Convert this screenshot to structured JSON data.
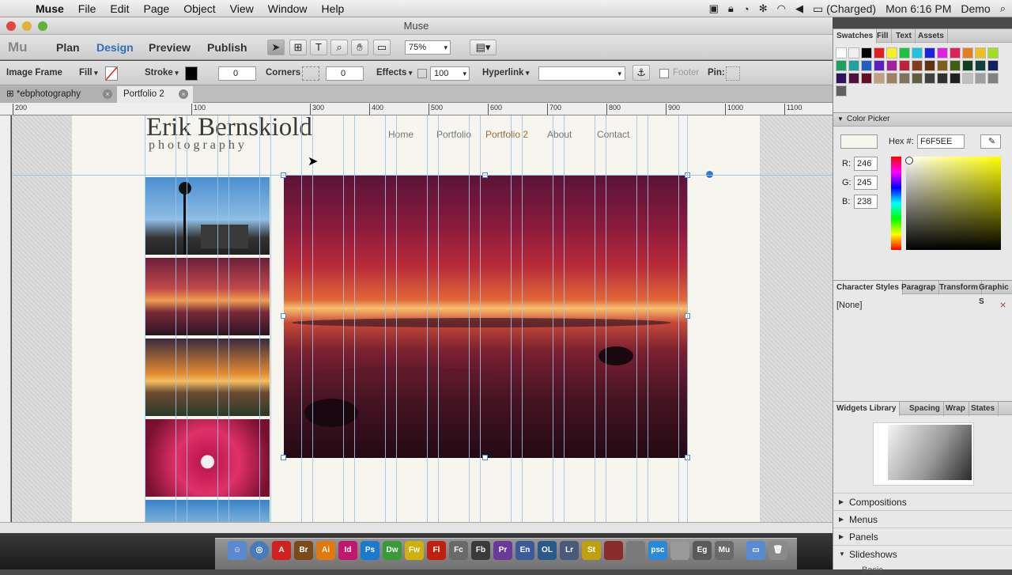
{
  "menubar": {
    "app": "Muse",
    "items": [
      "File",
      "Edit",
      "Page",
      "Object",
      "View",
      "Window",
      "Help"
    ],
    "battery": "(Charged)",
    "clock": "Mon 6:16 PM",
    "user": "Demo"
  },
  "window": {
    "title": "Muse"
  },
  "toolbar": {
    "logo": "Mu",
    "modes": [
      "Plan",
      "Design",
      "Preview",
      "Publish"
    ],
    "active_mode": "Design",
    "zoom": "75%"
  },
  "control_bar": {
    "object_type": "Image Frame",
    "fill_label": "Fill",
    "stroke_label": "Stroke",
    "stroke_width": "0",
    "corners_label": "Corners",
    "corners_value": "0",
    "effects_label": "Effects",
    "opacity": "100",
    "hyperlink_label": "Hyperlink",
    "hyperlink_value": "",
    "footer_label": "Footer",
    "pin_label": "Pin:"
  },
  "tabs": [
    "*ebphotography",
    "Portfolio 2"
  ],
  "active_tab": "Portfolio 2",
  "ruler_ticks": [
    "200",
    "100",
    "300",
    "400",
    "500",
    "600",
    "700",
    "800",
    "900",
    "1000",
    "1100"
  ],
  "site": {
    "brand_name": "Erik Bernskiold",
    "brand_sub": "p h o t o g r a p h y",
    "nav": [
      "Home",
      "Portfolio",
      "Portfolio 2",
      "About",
      "Contact"
    ],
    "active_nav": "Portfolio 2"
  },
  "panels": {
    "swatches_tabs": [
      "Swatches",
      "Fill",
      "Text",
      "Assets"
    ],
    "color_picker": {
      "title": "Color Picker",
      "hex_label": "Hex #:",
      "hex": "F6F5EE",
      "r_label": "R:",
      "r": "246",
      "g_label": "G:",
      "g": "245",
      "b_label": "B:",
      "b": "238"
    },
    "style_tabs": [
      "Character Styles",
      "Paragrap",
      "Transform",
      "Graphic S"
    ],
    "style_value": "[None]",
    "widget_tabs": [
      "Widgets Library",
      "Spacing",
      "Wrap",
      "States"
    ],
    "widget_sections": [
      "Compositions",
      "Menus",
      "Panels",
      "Slideshows"
    ],
    "widget_sub": "Basic"
  },
  "dock": [
    "Br",
    "Ai",
    "Id",
    "Ps",
    "Dw",
    "Fw",
    "Fl",
    "Fc",
    "Fb",
    "Pr",
    "En",
    "OL",
    "Lr",
    "St",
    "",
    "",
    "psc",
    "",
    "Eg",
    "Mu"
  ],
  "colors": {
    "accent_blue": "#2f6fbd",
    "page_bg": "#F6F5EE",
    "nav_active": "#9a6a3a",
    "guide": "#9fc2e8"
  }
}
